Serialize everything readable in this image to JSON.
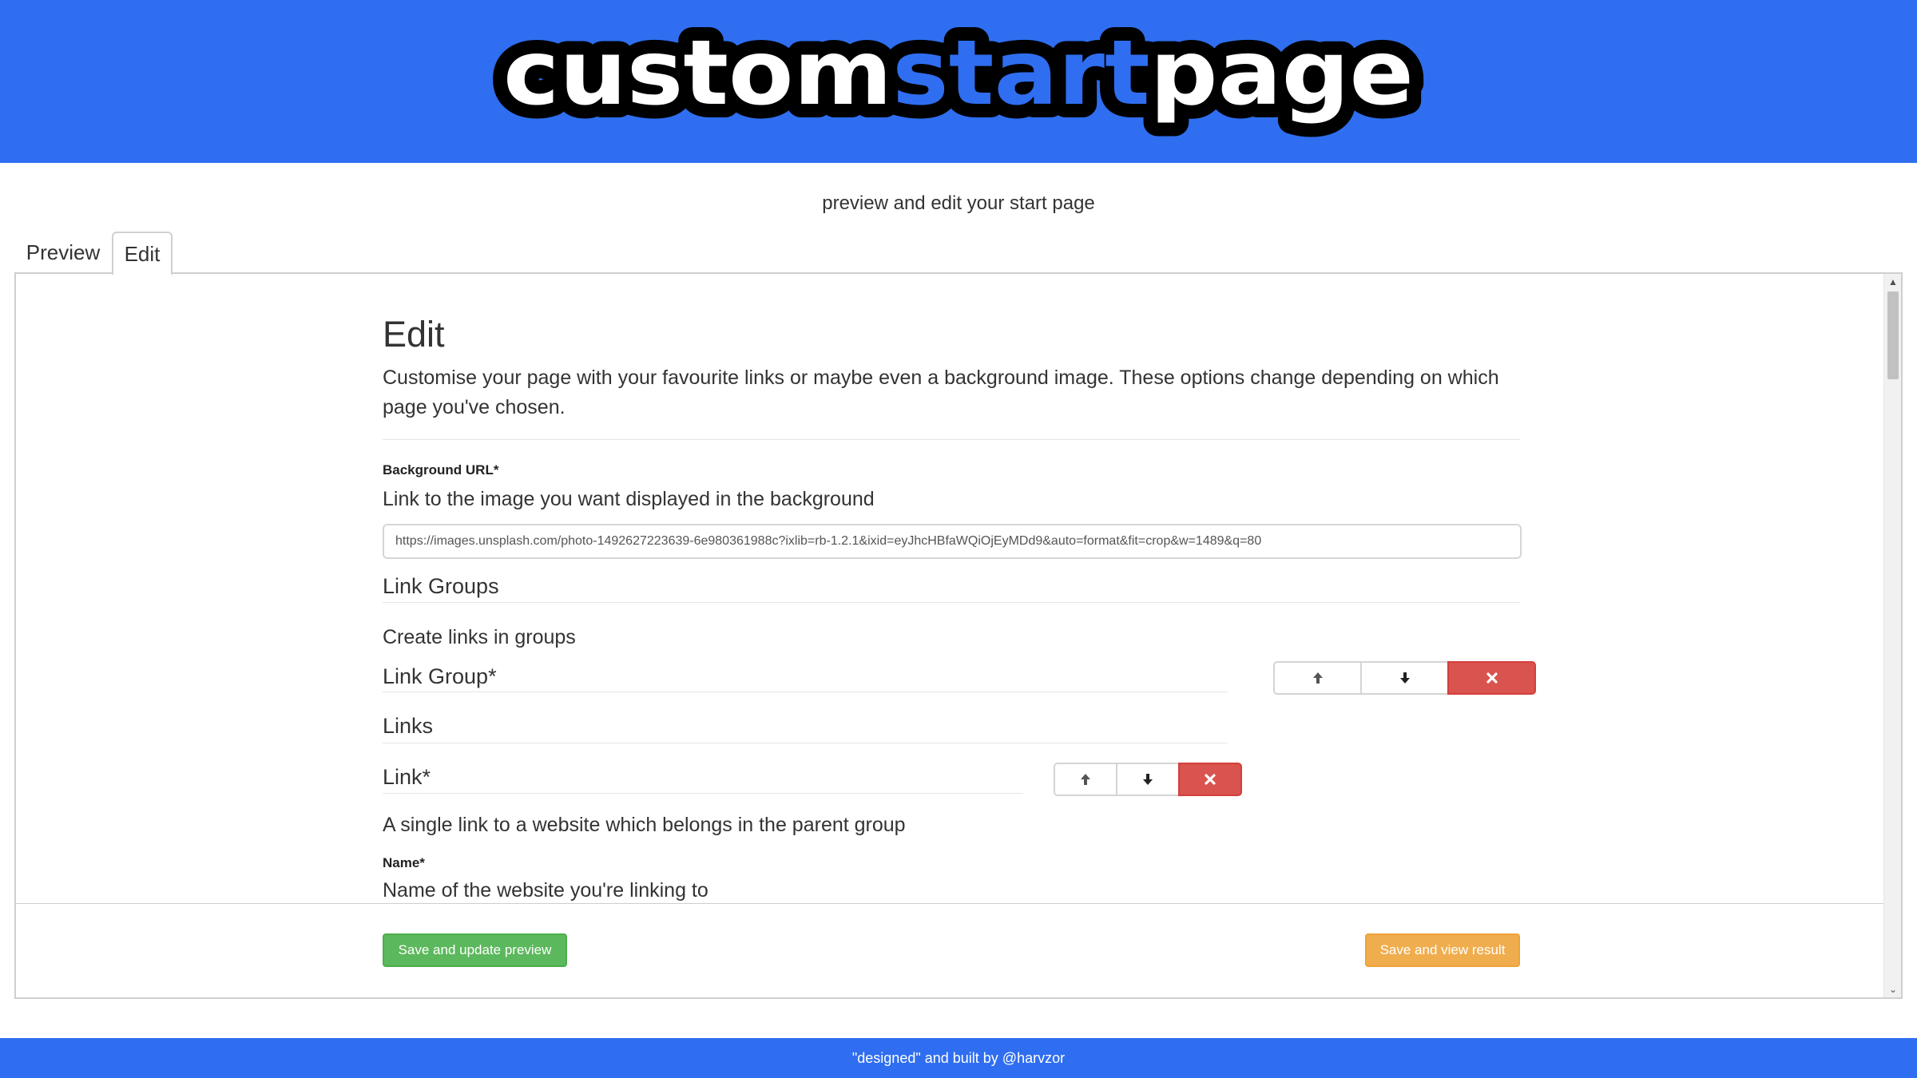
{
  "header": {
    "logo_custom": "custom",
    "logo_start": "start",
    "logo_page": "page",
    "subtitle": "preview and edit your start page"
  },
  "tabs": [
    {
      "label": "Preview",
      "active": false
    },
    {
      "label": "Edit",
      "active": true
    }
  ],
  "editor": {
    "title": "Edit",
    "description": "Customise your page with your favourite links or maybe even a background image. These options change depending on which page you've chosen.",
    "background": {
      "label": "Background URL*",
      "help": "Link to the image you want displayed in the background",
      "value": "https://images.unsplash.com/photo-1492627223639-6e980361988c?ixlib=rb-1.2.1&ixid=eyJhcHBfaWQiOjEyMDd9&auto=format&fit=crop&w=1489&q=80"
    },
    "link_groups": {
      "title": "Link Groups",
      "description": "Create links in groups",
      "group_title": "Link Group*",
      "links_title": "Links",
      "link_title": "Link*",
      "link_description": "A single link to a website which belongs in the parent group",
      "name_label": "Name*",
      "name_help": "Name of the website you're linking to"
    },
    "controls": {
      "move_up_icon": "arrow-up-icon",
      "move_down_icon": "arrow-down-icon",
      "remove_icon": "close-icon",
      "delete_color": "#d9534f"
    },
    "actions": {
      "save_preview": "Save and update preview",
      "save_view": "Save and view result"
    }
  },
  "footer": {
    "text": "\"designed\" and built by @harvzor"
  },
  "colors": {
    "brand_blue": "#2f6ef0",
    "success": "#5cb85c",
    "warning": "#f0ad4e",
    "danger": "#d9534f"
  }
}
